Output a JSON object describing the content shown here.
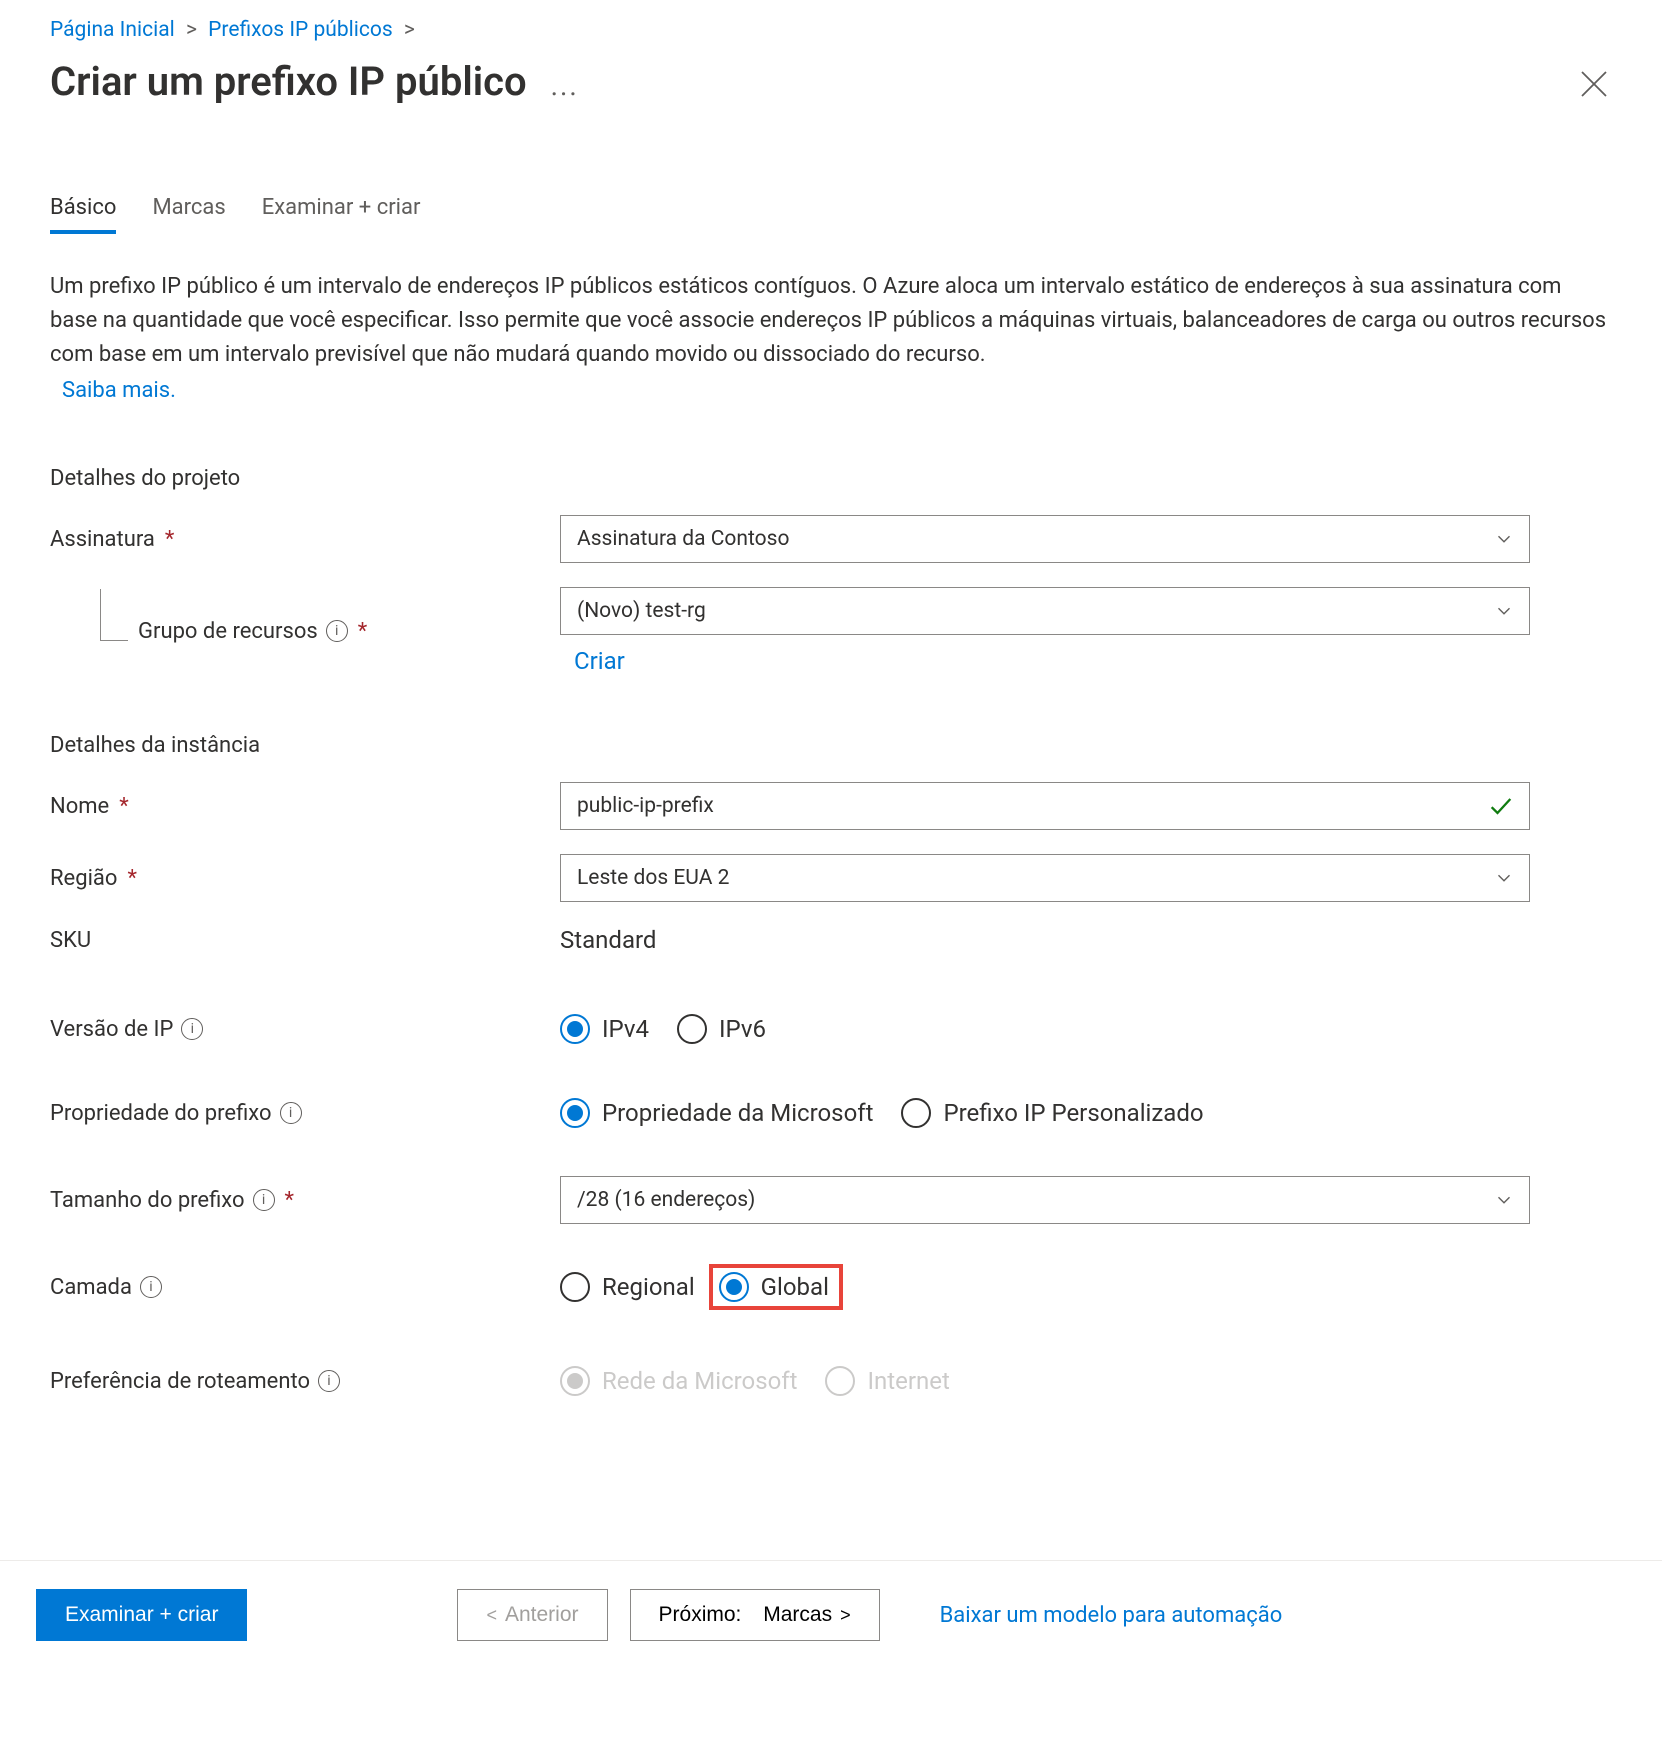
{
  "breadcrumb": {
    "home": "Página Inicial",
    "parent": "Prefixos IP públicos"
  },
  "header": {
    "title": "Criar um prefixo IP público",
    "more_label": "..."
  },
  "tabs": {
    "basic": "Básico",
    "tags": "Marcas",
    "review": "Examinar + criar"
  },
  "intro": {
    "text": "Um prefixo IP público é um intervalo de endereços IP públicos estáticos contíguos. O Azure aloca um intervalo estático de endereços à sua assinatura com base na quantidade que você especificar. Isso permite que você associe endereços IP públicos a máquinas virtuais, balanceadores de carga ou outros recursos com base em um intervalo previsível que não mudará quando movido ou dissociado do recurso.",
    "learn_more": "Saiba mais."
  },
  "sections": {
    "project_details": "Detalhes do projeto",
    "instance_details": "Detalhes da instância"
  },
  "fields": {
    "subscription": {
      "label": "Assinatura",
      "value": "Assinatura da Contoso"
    },
    "resource_group": {
      "label": "Grupo de recursos",
      "value": "(Novo) test-rg",
      "create_new": "Criar"
    },
    "name": {
      "label": "Nome",
      "value": "public-ip-prefix"
    },
    "region": {
      "label": "Região",
      "value": "Leste dos EUA 2"
    },
    "sku": {
      "label": "SKU",
      "value": "Standard"
    },
    "ip_version": {
      "label": "Versão de IP",
      "options": {
        "ipv4": "IPv4",
        "ipv6": "IPv6"
      }
    },
    "prefix_ownership": {
      "label": "Propriedade do prefixo",
      "options": {
        "microsoft": "Propriedade da Microsoft",
        "custom": "Prefixo IP Personalizado"
      }
    },
    "prefix_size": {
      "label": "Tamanho do prefixo",
      "value": "/28 (16 endereços)"
    },
    "tier": {
      "label": "Camada",
      "options": {
        "regional": "Regional",
        "global": "Global"
      }
    },
    "routing_preference": {
      "label": "Preferência de roteamento",
      "options": {
        "microsoft": "Rede da Microsoft",
        "internet": "Internet"
      }
    }
  },
  "footer": {
    "review_create": "Examinar + criar",
    "previous": "Anterior",
    "next_prefix": "Próximo:",
    "next_target": "Marcas",
    "download_template": "Baixar um modelo para automação"
  }
}
